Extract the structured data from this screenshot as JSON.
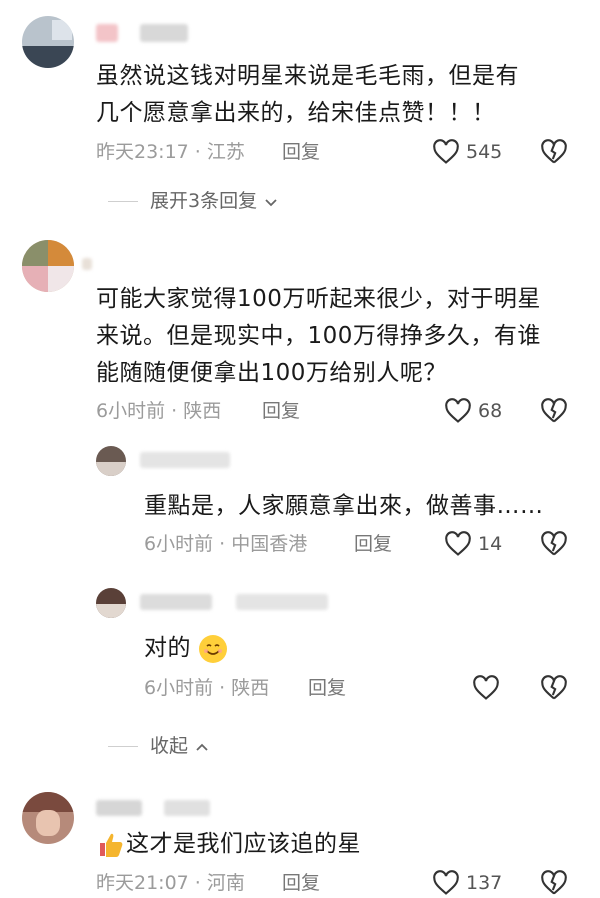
{
  "comments": [
    {
      "text_line1": "虽然说这钱对明星来说是毛毛雨，但是有",
      "text_line2": "几个愿意拿出来的，给宋佳点赞！！！",
      "meta": "昨天23:17 · 江苏",
      "reply_label": "回复",
      "likes": "545",
      "expand_label": "展开3条回复"
    },
    {
      "text_line1": "可能大家觉得100万听起来很少，对于明星",
      "text_line2": "来说。但是现实中，100万得挣多久，有谁",
      "text_line3": "能随随便便拿出100万给别人呢？",
      "meta": "6小时前 · 陕西",
      "reply_label": "回复",
      "likes": "68",
      "replies": [
        {
          "text": "重點是，人家願意拿出來，做善事……",
          "meta": "6小时前 · 中国香港",
          "reply_label": "回复",
          "likes": "14"
        },
        {
          "text": "对的",
          "meta": "6小时前 · 陕西",
          "reply_label": "回复",
          "likes": ""
        }
      ],
      "collapse_label": "收起"
    },
    {
      "text": "这才是我们应该追的星",
      "meta": "昨天21:07 · 河南",
      "reply_label": "回复",
      "likes": "137"
    }
  ],
  "colors": {
    "meta": "#9b9b9b",
    "text": "#1a1a1a",
    "divider": "#cfcfcf",
    "emoji": "#ffcf3a",
    "thumb": "#f5b52e"
  },
  "icons": {
    "like": "heart-outline-icon",
    "dislike": "broken-heart-icon",
    "chevron_down": "chevron-down-icon",
    "chevron_up": "chevron-up-icon"
  }
}
